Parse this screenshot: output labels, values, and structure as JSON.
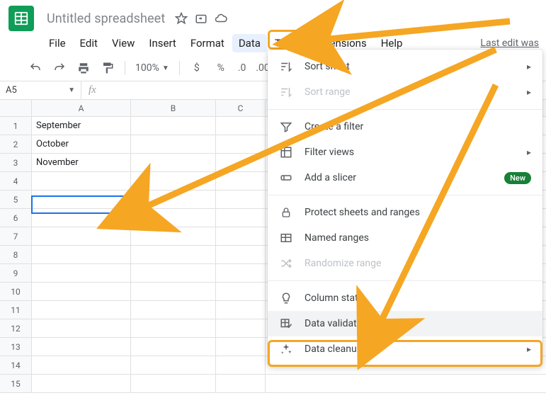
{
  "header": {
    "title": "Untitled spreadsheet",
    "last_edit": "Last edit was"
  },
  "menubar": {
    "items": [
      "File",
      "Edit",
      "View",
      "Insert",
      "Format",
      "Data",
      "Tools",
      "Extensions",
      "Help"
    ]
  },
  "toolbar": {
    "zoom": "100%",
    "currency": "$",
    "percent": "%",
    "dec1": ".0",
    "dec2": ".00"
  },
  "fxbar": {
    "namebox": "A5",
    "fx": "fx"
  },
  "grid": {
    "columns": [
      "A",
      "B",
      "C"
    ],
    "rows": [
      {
        "n": "1",
        "A": "September"
      },
      {
        "n": "2",
        "A": "October"
      },
      {
        "n": "3",
        "A": "November"
      },
      {
        "n": "4",
        "A": ""
      },
      {
        "n": "5",
        "A": ""
      },
      {
        "n": "6",
        "A": ""
      },
      {
        "n": "7",
        "A": ""
      },
      {
        "n": "8",
        "A": ""
      },
      {
        "n": "9",
        "A": ""
      },
      {
        "n": "10",
        "A": ""
      },
      {
        "n": "11",
        "A": ""
      },
      {
        "n": "12",
        "A": ""
      },
      {
        "n": "13",
        "A": ""
      },
      {
        "n": "14",
        "A": ""
      },
      {
        "n": "15",
        "A": ""
      }
    ],
    "selected": "A5"
  },
  "menu": {
    "sort_sheet": "Sort sheet",
    "sort_range": "Sort range",
    "create_filter": "Create a filter",
    "filter_views": "Filter views",
    "add_slicer": "Add a slicer",
    "new_badge": "New",
    "protect": "Protect sheets and ranges",
    "named_ranges": "Named ranges",
    "randomize": "Randomize range",
    "column_stats": "Column stats",
    "data_validation": "Data validation",
    "data_cleanup": "Data cleanup"
  }
}
